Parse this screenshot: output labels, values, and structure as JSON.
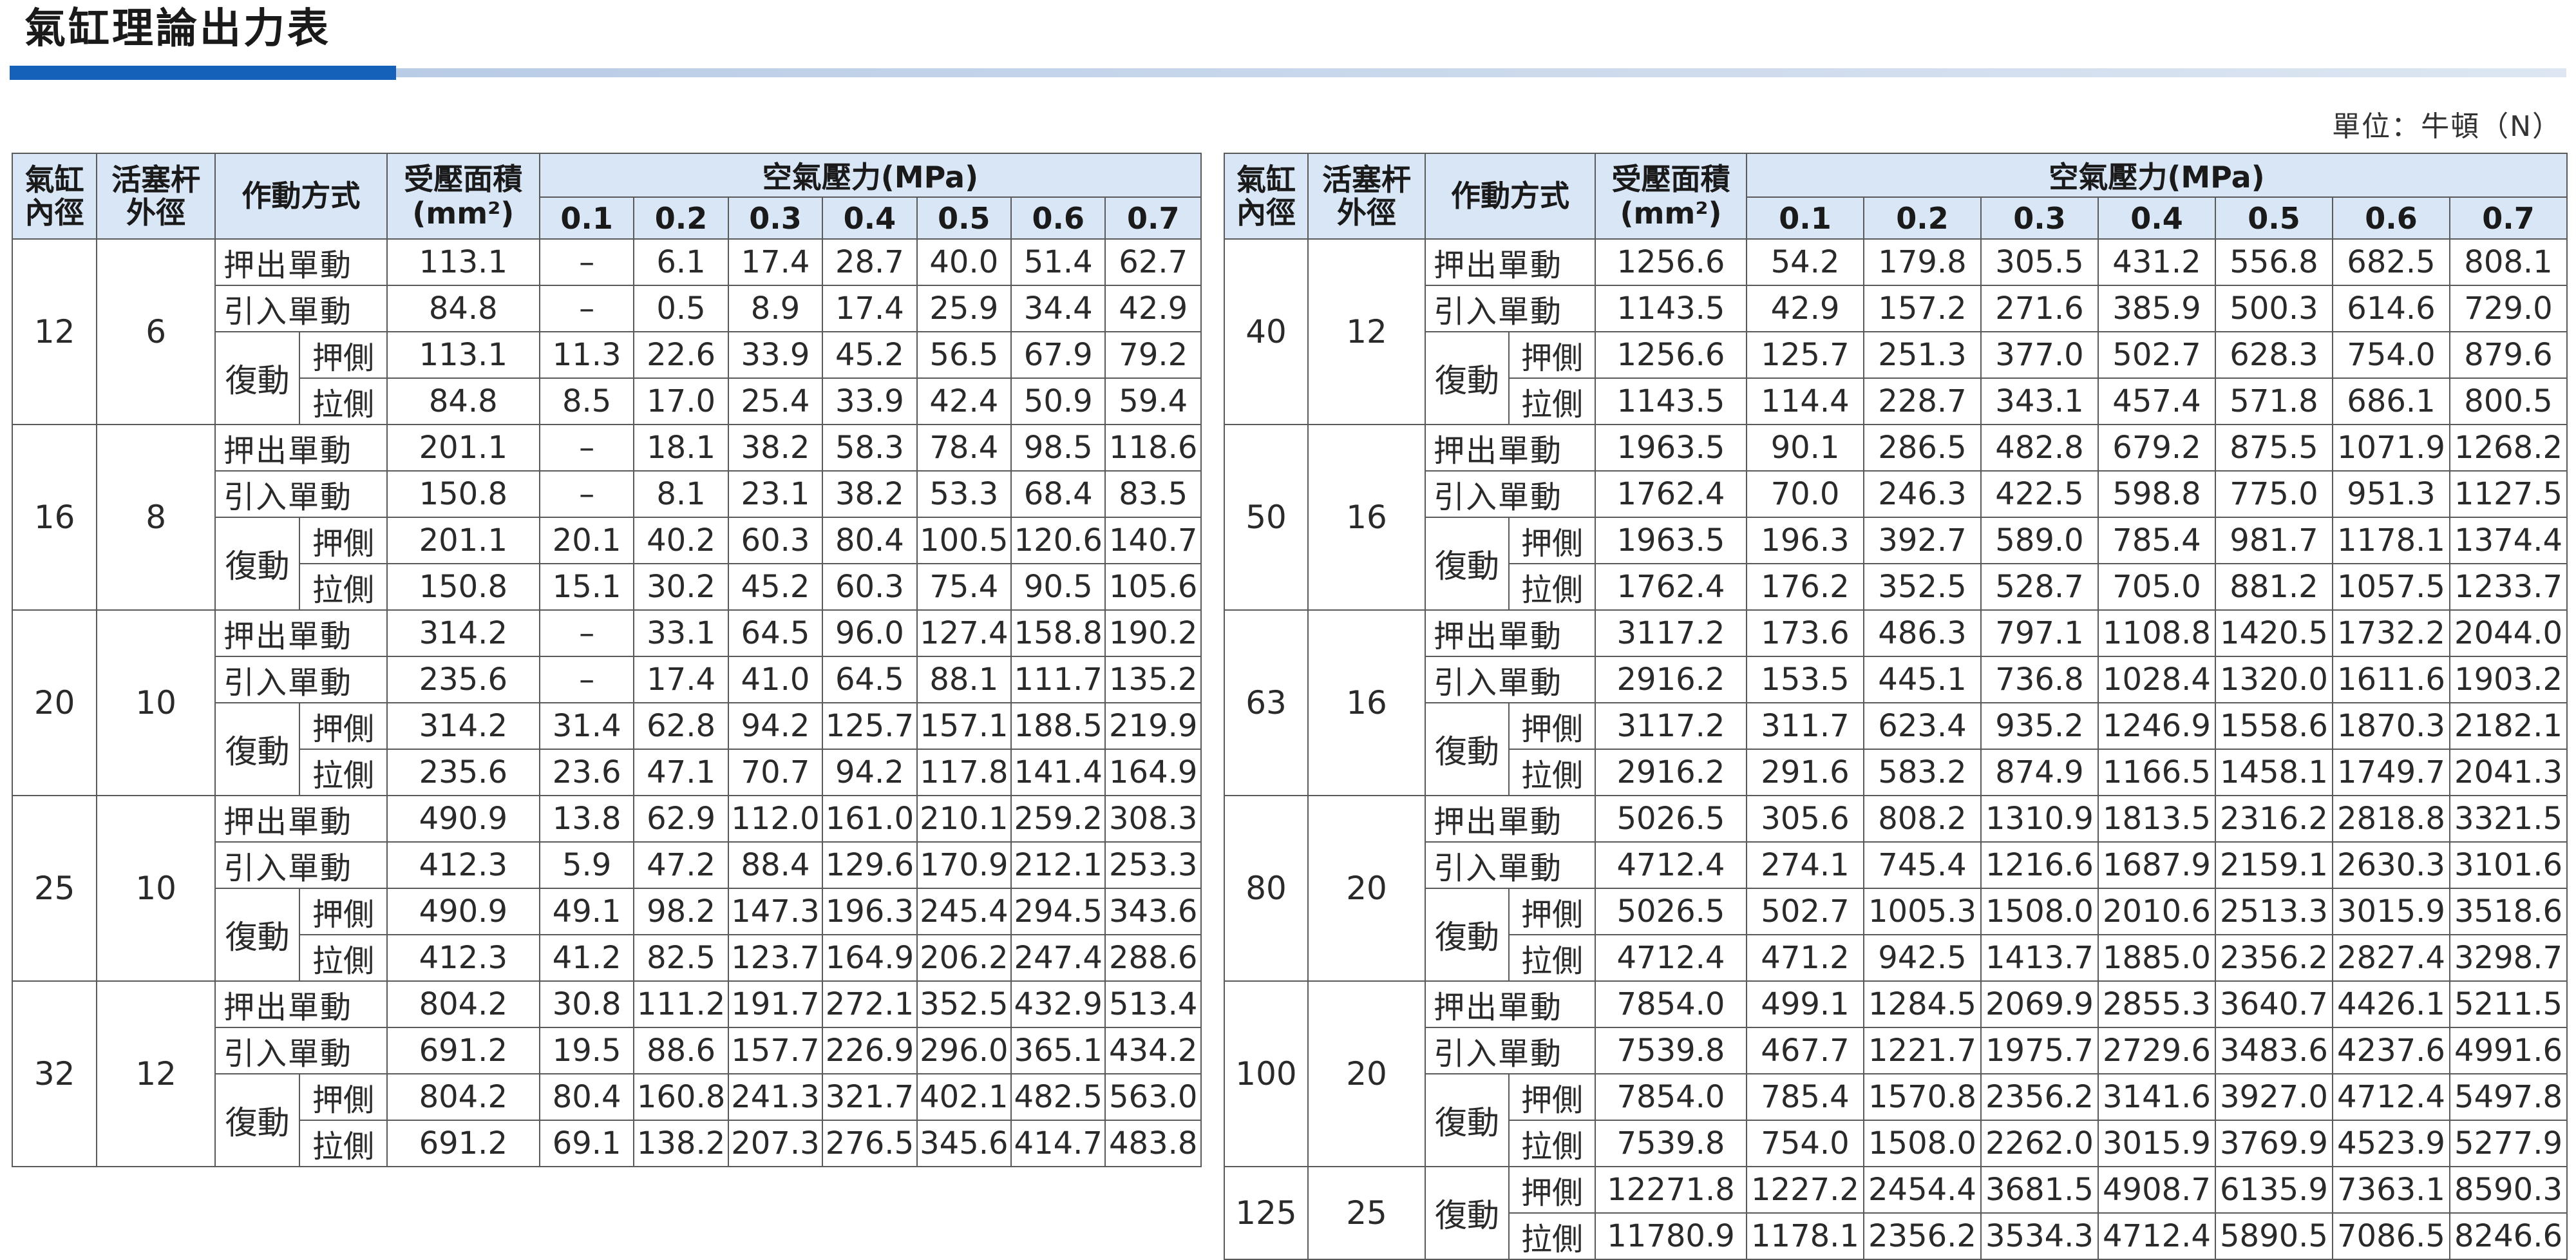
{
  "title": "氣缸理論出力表",
  "unit_label": "單位：牛頓（N）",
  "headers": {
    "bore": "氣缸內徑",
    "rod": "活塞杆外徑",
    "mode": "作動方式",
    "area": "受壓面積",
    "area_unit": "(mm²)",
    "pressure": "空氣壓力(MPa)",
    "pressures": [
      "0.1",
      "0.2",
      "0.3",
      "0.4",
      "0.5",
      "0.6",
      "0.7"
    ]
  },
  "labels": {
    "push_single": "押出單動",
    "pull_single": "引入單動",
    "double": "復動",
    "push_side": "押側",
    "pull_side": "拉側"
  },
  "tables": [
    {
      "groups": [
        {
          "bore": "12",
          "rod": "6",
          "rows": [
            {
              "area": "113.1",
              "v": [
                "–",
                "6.1",
                "17.4",
                "28.7",
                "40.0",
                "51.4",
                "62.7"
              ]
            },
            {
              "area": "84.8",
              "v": [
                "–",
                "0.5",
                "8.9",
                "17.4",
                "25.9",
                "34.4",
                "42.9"
              ]
            },
            {
              "area": "113.1",
              "v": [
                "11.3",
                "22.6",
                "33.9",
                "45.2",
                "56.5",
                "67.9",
                "79.2"
              ]
            },
            {
              "area": "84.8",
              "v": [
                "8.5",
                "17.0",
                "25.4",
                "33.9",
                "42.4",
                "50.9",
                "59.4"
              ]
            }
          ]
        },
        {
          "bore": "16",
          "rod": "8",
          "rows": [
            {
              "area": "201.1",
              "v": [
                "–",
                "18.1",
                "38.2",
                "58.3",
                "78.4",
                "98.5",
                "118.6"
              ]
            },
            {
              "area": "150.8",
              "v": [
                "–",
                "8.1",
                "23.1",
                "38.2",
                "53.3",
                "68.4",
                "83.5"
              ]
            },
            {
              "area": "201.1",
              "v": [
                "20.1",
                "40.2",
                "60.3",
                "80.4",
                "100.5",
                "120.6",
                "140.7"
              ]
            },
            {
              "area": "150.8",
              "v": [
                "15.1",
                "30.2",
                "45.2",
                "60.3",
                "75.4",
                "90.5",
                "105.6"
              ]
            }
          ]
        },
        {
          "bore": "20",
          "rod": "10",
          "rows": [
            {
              "area": "314.2",
              "v": [
                "–",
                "33.1",
                "64.5",
                "96.0",
                "127.4",
                "158.8",
                "190.2"
              ]
            },
            {
              "area": "235.6",
              "v": [
                "–",
                "17.4",
                "41.0",
                "64.5",
                "88.1",
                "111.7",
                "135.2"
              ]
            },
            {
              "area": "314.2",
              "v": [
                "31.4",
                "62.8",
                "94.2",
                "125.7",
                "157.1",
                "188.5",
                "219.9"
              ]
            },
            {
              "area": "235.6",
              "v": [
                "23.6",
                "47.1",
                "70.7",
                "94.2",
                "117.8",
                "141.4",
                "164.9"
              ]
            }
          ]
        },
        {
          "bore": "25",
          "rod": "10",
          "rows": [
            {
              "area": "490.9",
              "v": [
                "13.8",
                "62.9",
                "112.0",
                "161.0",
                "210.1",
                "259.2",
                "308.3"
              ]
            },
            {
              "area": "412.3",
              "v": [
                "5.9",
                "47.2",
                "88.4",
                "129.6",
                "170.9",
                "212.1",
                "253.3"
              ]
            },
            {
              "area": "490.9",
              "v": [
                "49.1",
                "98.2",
                "147.3",
                "196.3",
                "245.4",
                "294.5",
                "343.6"
              ]
            },
            {
              "area": "412.3",
              "v": [
                "41.2",
                "82.5",
                "123.7",
                "164.9",
                "206.2",
                "247.4",
                "288.6"
              ]
            }
          ]
        },
        {
          "bore": "32",
          "rod": "12",
          "rows": [
            {
              "area": "804.2",
              "v": [
                "30.8",
                "111.2",
                "191.7",
                "272.1",
                "352.5",
                "432.9",
                "513.4"
              ]
            },
            {
              "area": "691.2",
              "v": [
                "19.5",
                "88.6",
                "157.7",
                "226.9",
                "296.0",
                "365.1",
                "434.2"
              ]
            },
            {
              "area": "804.2",
              "v": [
                "80.4",
                "160.8",
                "241.3",
                "321.7",
                "402.1",
                "482.5",
                "563.0"
              ]
            },
            {
              "area": "691.2",
              "v": [
                "69.1",
                "138.2",
                "207.3",
                "276.5",
                "345.6",
                "414.7",
                "483.8"
              ]
            }
          ]
        }
      ]
    },
    {
      "groups": [
        {
          "bore": "40",
          "rod": "12",
          "rows": [
            {
              "area": "1256.6",
              "v": [
                "54.2",
                "179.8",
                "305.5",
                "431.2",
                "556.8",
                "682.5",
                "808.1"
              ]
            },
            {
              "area": "1143.5",
              "v": [
                "42.9",
                "157.2",
                "271.6",
                "385.9",
                "500.3",
                "614.6",
                "729.0"
              ]
            },
            {
              "area": "1256.6",
              "v": [
                "125.7",
                "251.3",
                "377.0",
                "502.7",
                "628.3",
                "754.0",
                "879.6"
              ]
            },
            {
              "area": "1143.5",
              "v": [
                "114.4",
                "228.7",
                "343.1",
                "457.4",
                "571.8",
                "686.1",
                "800.5"
              ]
            }
          ]
        },
        {
          "bore": "50",
          "rod": "16",
          "rows": [
            {
              "area": "1963.5",
              "v": [
                "90.1",
                "286.5",
                "482.8",
                "679.2",
                "875.5",
                "1071.9",
                "1268.2"
              ]
            },
            {
              "area": "1762.4",
              "v": [
                "70.0",
                "246.3",
                "422.5",
                "598.8",
                "775.0",
                "951.3",
                "1127.5"
              ]
            },
            {
              "area": "1963.5",
              "v": [
                "196.3",
                "392.7",
                "589.0",
                "785.4",
                "981.7",
                "1178.1",
                "1374.4"
              ]
            },
            {
              "area": "1762.4",
              "v": [
                "176.2",
                "352.5",
                "528.7",
                "705.0",
                "881.2",
                "1057.5",
                "1233.7"
              ]
            }
          ]
        },
        {
          "bore": "63",
          "rod": "16",
          "rows": [
            {
              "area": "3117.2",
              "v": [
                "173.6",
                "486.3",
                "797.1",
                "1108.8",
                "1420.5",
                "1732.2",
                "2044.0"
              ]
            },
            {
              "area": "2916.2",
              "v": [
                "153.5",
                "445.1",
                "736.8",
                "1028.4",
                "1320.0",
                "1611.6",
                "1903.2"
              ]
            },
            {
              "area": "3117.2",
              "v": [
                "311.7",
                "623.4",
                "935.2",
                "1246.9",
                "1558.6",
                "1870.3",
                "2182.1"
              ]
            },
            {
              "area": "2916.2",
              "v": [
                "291.6",
                "583.2",
                "874.9",
                "1166.5",
                "1458.1",
                "1749.7",
                "2041.3"
              ]
            }
          ]
        },
        {
          "bore": "80",
          "rod": "20",
          "rows": [
            {
              "area": "5026.5",
              "v": [
                "305.6",
                "808.2",
                "1310.9",
                "1813.5",
                "2316.2",
                "2818.8",
                "3321.5"
              ]
            },
            {
              "area": "4712.4",
              "v": [
                "274.1",
                "745.4",
                "1216.6",
                "1687.9",
                "2159.1",
                "2630.3",
                "3101.6"
              ]
            },
            {
              "area": "5026.5",
              "v": [
                "502.7",
                "1005.3",
                "1508.0",
                "2010.6",
                "2513.3",
                "3015.9",
                "3518.6"
              ]
            },
            {
              "area": "4712.4",
              "v": [
                "471.2",
                "942.5",
                "1413.7",
                "1885.0",
                "2356.2",
                "2827.4",
                "3298.7"
              ]
            }
          ]
        },
        {
          "bore": "100",
          "rod": "20",
          "rows": [
            {
              "area": "7854.0",
              "v": [
                "499.1",
                "1284.5",
                "2069.9",
                "2855.3",
                "3640.7",
                "4426.1",
                "5211.5"
              ]
            },
            {
              "area": "7539.8",
              "v": [
                "467.7",
                "1221.7",
                "1975.7",
                "2729.6",
                "3483.6",
                "4237.6",
                "4991.6"
              ]
            },
            {
              "area": "7854.0",
              "v": [
                "785.4",
                "1570.8",
                "2356.2",
                "3141.6",
                "3927.0",
                "4712.4",
                "5497.8"
              ]
            },
            {
              "area": "7539.8",
              "v": [
                "754.0",
                "1508.0",
                "2262.0",
                "3015.9",
                "3769.9",
                "4523.9",
                "5277.9"
              ]
            }
          ]
        },
        {
          "bore": "125",
          "rod": "25",
          "double_only": true,
          "rows": [
            {
              "area": "12271.8",
              "v": [
                "1227.2",
                "2454.4",
                "3681.5",
                "4908.7",
                "6135.9",
                "7363.1",
                "8590.3"
              ]
            },
            {
              "area": "11780.9",
              "v": [
                "1178.1",
                "2356.2",
                "3534.3",
                "4712.4",
                "5890.5",
                "7086.5",
                "8246.6"
              ]
            }
          ]
        }
      ]
    }
  ]
}
